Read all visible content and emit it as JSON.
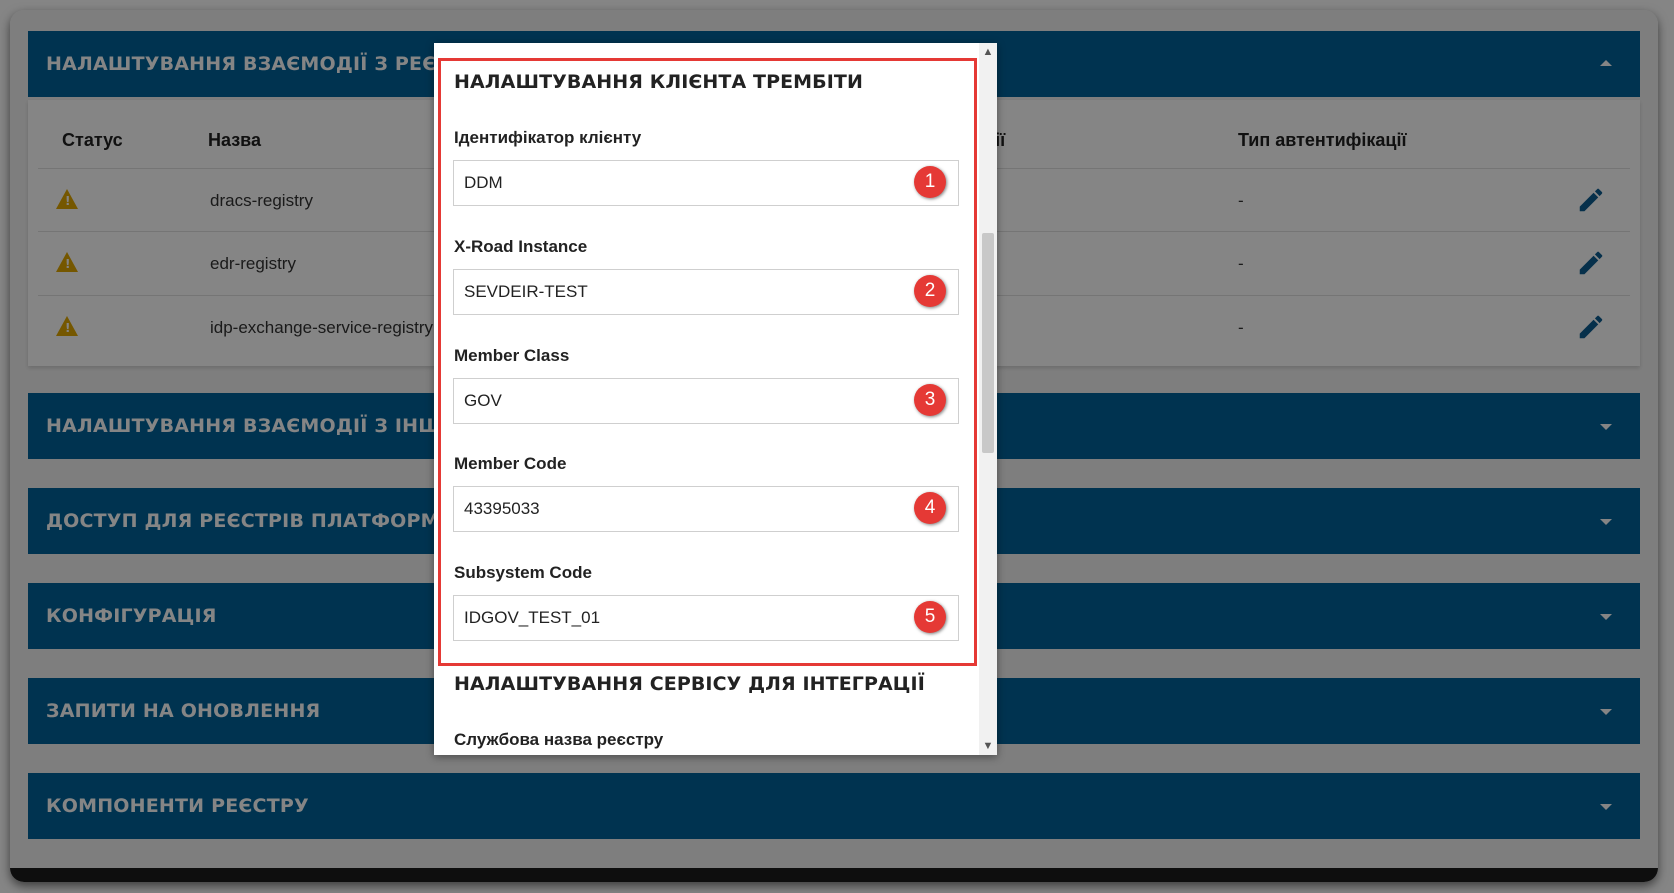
{
  "sections": {
    "registries": {
      "title": "НАЛАШТУВАННЯ ВЗАЄМОДІЇ З РЕЄСТРАМИ ЧЕР",
      "columns": {
        "status": "Статус",
        "name": "Назва",
        "integration": "рації",
        "auth_type": "Тип автентифікації"
      },
      "rows": [
        {
          "name": "dracs-registry",
          "auth": "-"
        },
        {
          "name": "edr-registry",
          "auth": "-"
        },
        {
          "name": "idp-exchange-service-registry",
          "auth": "-"
        }
      ]
    },
    "other_systems": {
      "title": "НАЛАШТУВАННЯ ВЗАЄМОДІЇ З ІНШИМИ СИСТЕМ"
    },
    "access": {
      "title": "ДОСТУП ДЛЯ РЕЄСТРІВ ПЛАТФОРМИ ТА ЗОВНІШ"
    },
    "configuration": {
      "title": "КОНФІГУРАЦІЯ"
    },
    "update_requests": {
      "title": "ЗАПИТИ НА ОНОВЛЕННЯ"
    },
    "components": {
      "title": "КОМПОНЕНТИ РЕЄСТРУ"
    }
  },
  "modal": {
    "client_section_title": "НАЛАШТУВАННЯ КЛІЄНТА ТРЕМБІТИ",
    "fields": [
      {
        "label": "Ідентифікатор клієнту",
        "value": "DDM",
        "badge": "1"
      },
      {
        "label": "X-Road Instance",
        "value": "SEVDEIR-TEST",
        "badge": "2"
      },
      {
        "label": "Member Class",
        "value": "GOV",
        "badge": "3"
      },
      {
        "label": "Member Code",
        "value": "43395033",
        "badge": "4"
      },
      {
        "label": "Subsystem Code",
        "value": "IDGOV_TEST_01",
        "badge": "5"
      }
    ],
    "service_section_title": "НАЛАШТУВАННЯ СЕРВІСУ ДЛЯ ІНТЕГРАЦІЇ",
    "service_field_label": "Службова назва реєстру"
  },
  "colors": {
    "accordion_header": "#016299",
    "highlight": "#e53935",
    "warning": "#e0a800",
    "edit_icon": "#0d5c91"
  },
  "icons": {
    "status": "warning-icon",
    "edit": "pencil-icon",
    "collapse": "chevron-up-icon",
    "expand": "chevron-down-icon"
  }
}
